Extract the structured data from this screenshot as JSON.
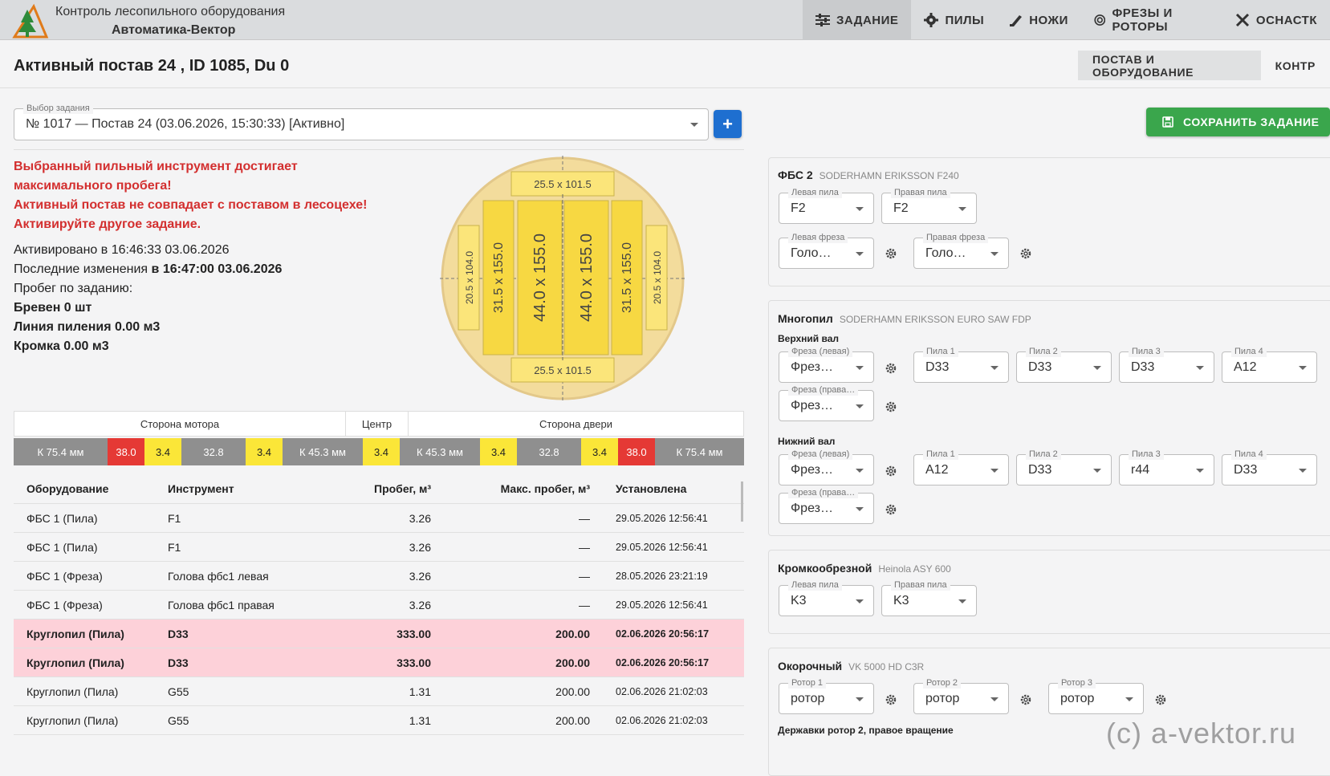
{
  "header": {
    "title": "Контроль лесопильного оборудования",
    "subtitle": "Автоматика-Вектор",
    "nav": [
      {
        "label": "ЗАДАНИЕ",
        "icon": "sliders-icon"
      },
      {
        "label": "ПИЛЫ",
        "icon": "gear-icon"
      },
      {
        "label": "НОЖИ",
        "icon": "knife-icon"
      },
      {
        "label": "ФРЕЗЫ И РОТОРЫ",
        "icon": "circle-icon"
      },
      {
        "label": "ОСНАСТК",
        "icon": "tools-icon"
      }
    ]
  },
  "page": {
    "title": "Активный постав 24 , ID 1085, Du 0",
    "tabs": [
      "ПОСТАВ И ОБОРУДОВАНИЕ",
      "КОНТР"
    ]
  },
  "task_select": {
    "label": "Выбор задания",
    "value": "№ 1017 — Постав 24 (03.06.2026, 15:30:33) [Активно]",
    "add_label": "+"
  },
  "warnings": [
    "Выбранный пильный инструмент достигает",
    "максимального пробега!",
    "Активный постав не совпадает с поставом в лесоцехе!",
    "Активируйте другое задание."
  ],
  "info": {
    "activated": "Активировано в 16:46:33 03.06.2026",
    "last_change_label": "Последние изменения",
    "last_change_value": "в 16:47:00 03.06.2026",
    "run_label": "Пробег по заданию:",
    "logs": "Бревен 0 шт",
    "line": "Линия пиления 0.00 м3",
    "edge": "Кромка 0.00 м3"
  },
  "diagram": {
    "top_board": "25.5 x 101.5",
    "bottom_board": "25.5 x 101.5",
    "side_left": "20.5 x 104.0",
    "side_right": "20.5 x 104.0",
    "b1": "31.5 x 155.0",
    "b2": "44.0 x 155.0",
    "b3": "44.0 x 155.0",
    "b4": "31.5 x 155.0"
  },
  "strip": {
    "headers": [
      "Сторона мотора",
      "Центр",
      "Сторона двери"
    ],
    "cells": [
      {
        "text": "К 75.4 мм",
        "kind": "gray"
      },
      {
        "text": "38.0",
        "kind": "red"
      },
      {
        "text": "3.4",
        "kind": "yellow"
      },
      {
        "text": "32.8",
        "kind": "gray"
      },
      {
        "text": "3.4",
        "kind": "yellow"
      },
      {
        "text": "К 45.3 мм",
        "kind": "gray"
      },
      {
        "text": "3.4",
        "kind": "yellow"
      },
      {
        "text": "К 45.3 мм",
        "kind": "gray"
      },
      {
        "text": "3.4",
        "kind": "yellow"
      },
      {
        "text": "32.8",
        "kind": "gray"
      },
      {
        "text": "3.4",
        "kind": "yellow"
      },
      {
        "text": "38.0",
        "kind": "red"
      },
      {
        "text": "К 75.4 мм",
        "kind": "gray"
      }
    ]
  },
  "table": {
    "headers": [
      "Оборудование",
      "Инструмент",
      "Пробег, м³",
      "Макс. пробег, м³",
      "Установлена"
    ],
    "rows": [
      {
        "eq": "ФБС 1 (Пила)",
        "tool": "F1",
        "run": "3.26",
        "max": "—",
        "set": "29.05.2026 12:56:41",
        "hl": false
      },
      {
        "eq": "ФБС 1 (Пила)",
        "tool": "F1",
        "run": "3.26",
        "max": "—",
        "set": "29.05.2026 12:56:41",
        "hl": false
      },
      {
        "eq": "ФБС 1 (Фреза)",
        "tool": "Голова фбс1 левая",
        "run": "3.26",
        "max": "—",
        "set": "28.05.2026 23:21:19",
        "hl": false
      },
      {
        "eq": "ФБС 1 (Фреза)",
        "tool": "Голова фбс1 правая",
        "run": "3.26",
        "max": "—",
        "set": "29.05.2026 12:56:41",
        "hl": false
      },
      {
        "eq": "Круглопил (Пила)",
        "tool": "D33",
        "run": "333.00",
        "max": "200.00",
        "set": "02.06.2026 20:56:17",
        "hl": true
      },
      {
        "eq": "Круглопил (Пила)",
        "tool": "D33",
        "run": "333.00",
        "max": "200.00",
        "set": "02.06.2026 20:56:17",
        "hl": true
      },
      {
        "eq": "Круглопил (Пила)",
        "tool": "G55",
        "run": "1.31",
        "max": "200.00",
        "set": "02.06.2026 21:02:03",
        "hl": false
      },
      {
        "eq": "Круглопил (Пила)",
        "tool": "G55",
        "run": "1.31",
        "max": "200.00",
        "set": "02.06.2026 21:02:03",
        "hl": false
      }
    ]
  },
  "right": {
    "save_label": "СОХРАНИТЬ ЗАДАНИЕ",
    "fbs": {
      "title": "ФБС 2",
      "model": "SODERHAMN ERIKSSON F240",
      "left_saw_label": "Левая пила",
      "left_saw": "F2",
      "right_saw_label": "Правая пила",
      "right_saw": "F2",
      "left_mill_label": "Левая фреза",
      "left_mill": "Голо…",
      "right_mill_label": "Правая фреза",
      "right_mill": "Голо…"
    },
    "multi": {
      "title": "Многопил",
      "model": "SODERHAMN ERIKSSON EURO SAW FDP",
      "upper": "Верхний вал",
      "lower": "Нижний вал",
      "mill_left_label": "Фреза (левая)",
      "mill_right_label": "Фреза (права…",
      "mill_value": "Фрез…",
      "saw_labels": [
        "Пила 1",
        "Пила 2",
        "Пила 3",
        "Пила 4"
      ],
      "upper_saws": [
        "D33",
        "D33",
        "D33",
        "A12"
      ],
      "lower_saws": [
        "A12",
        "D33",
        "r44",
        "D33"
      ]
    },
    "edger": {
      "title": "Кромкообрезной",
      "model": "Heinola ASY 600",
      "left_label": "Левая пила",
      "left": "K3",
      "right_label": "Правая пила",
      "right": "K3"
    },
    "debarker": {
      "title": "Окорочный",
      "model": "VK 5000 HD C3R",
      "rotor_labels": [
        "Ротор 1",
        "Ротор 2",
        "Ротор 3"
      ],
      "rotor_value": "ротор",
      "holders": "Державки ротор 2, правое вращение"
    }
  },
  "watermark": "(c) a-vektor.ru"
}
